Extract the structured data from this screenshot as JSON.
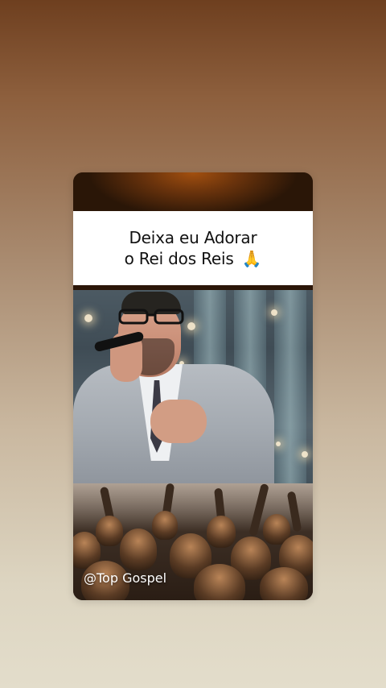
{
  "post": {
    "title_line1": "Deixa eu Adorar",
    "title_line2": "o Rei dos Reis",
    "title_emoji": "🙏",
    "watermark_handle": "@Top Gospel"
  },
  "icons": {
    "emoji": "folded-hands-icon"
  },
  "colors": {
    "card_header": "#6a330c",
    "title_panel": "#ffffff",
    "title_text": "#111111",
    "watermark_text": "#ffffff"
  }
}
